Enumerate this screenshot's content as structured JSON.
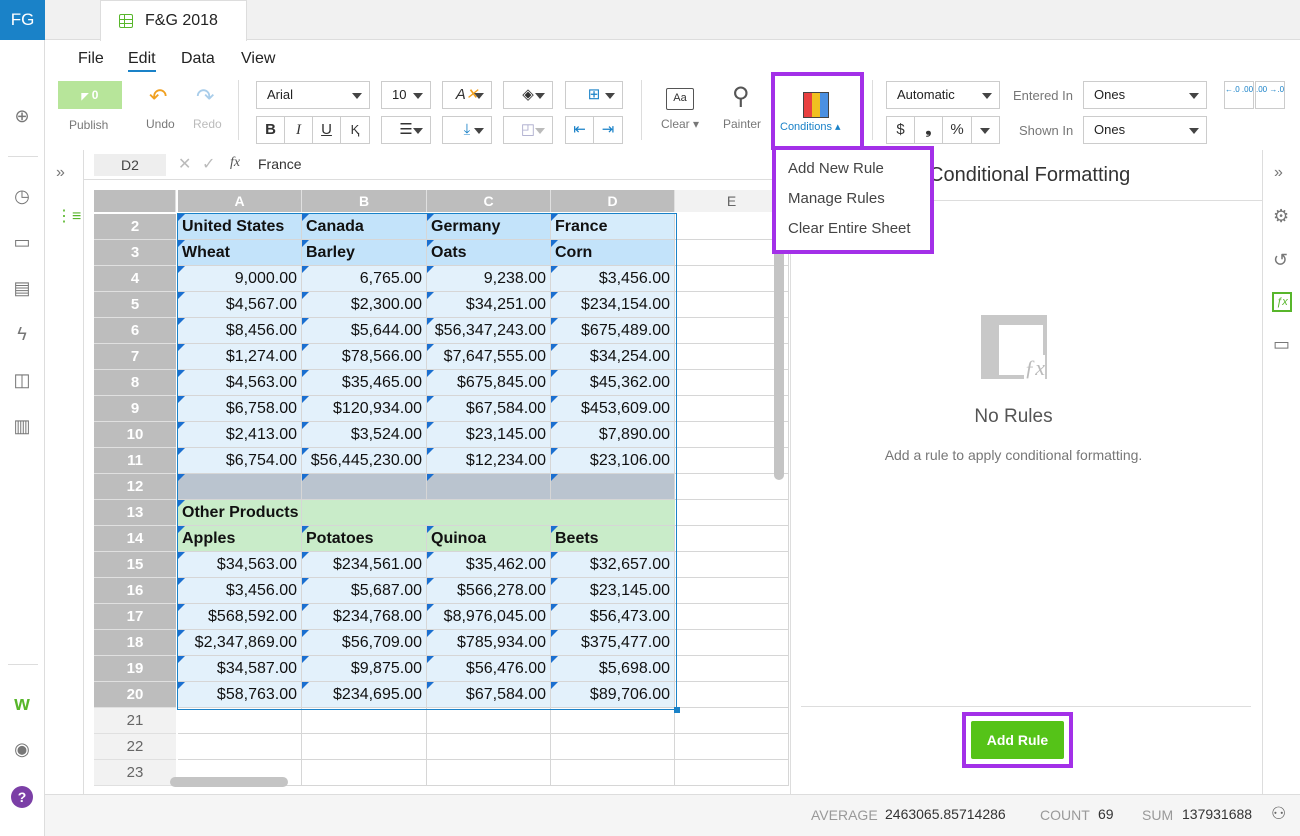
{
  "app": {
    "logo": "FG",
    "tab_title": "F&G 2018"
  },
  "menus": [
    "File",
    "Edit",
    "Data",
    "View"
  ],
  "toolbar": {
    "publish_count": "0",
    "publish_label": "Publish",
    "undo_label": "Undo",
    "redo_label": "Redo",
    "font": "Arial",
    "font_size": "10",
    "bold": "B",
    "italic": "I",
    "underline": "U",
    "clear_label": "Clear",
    "painter_label": "Painter",
    "conditions_label": "Conditions",
    "number_format": "Automatic",
    "currency": "$",
    "comma": "❟",
    "percent": "%",
    "entered_in_label": "Entered In",
    "entered_in_value": "Ones",
    "shown_in_label": "Shown In",
    "shown_in_value": "Ones",
    "dec_increase": "←.0 .00",
    "dec_decrease": ".00 →.0"
  },
  "formula_bar": {
    "cell_ref": "D2",
    "fx": "fx",
    "value": "France"
  },
  "columns": [
    "A",
    "B",
    "C",
    "D",
    "E"
  ],
  "rows": [
    {
      "n": "2",
      "cells": [
        "United States",
        "Canada",
        "Germany",
        "France"
      ],
      "kind": "header"
    },
    {
      "n": "3",
      "cells": [
        "Wheat",
        "Barley",
        "Oats",
        "Corn"
      ],
      "kind": "header"
    },
    {
      "n": "4",
      "cells": [
        "9,000.00",
        "6,765.00",
        "9,238.00",
        "$3,456.00"
      ],
      "kind": "num"
    },
    {
      "n": "5",
      "cells": [
        "$4,567.00",
        "$2,300.00",
        "$34,251.00",
        "$234,154.00"
      ],
      "kind": "num"
    },
    {
      "n": "6",
      "cells": [
        "$8,456.00",
        "$5,644.00",
        "$56,347,243.00",
        "$675,489.00"
      ],
      "kind": "num"
    },
    {
      "n": "7",
      "cells": [
        "$1,274.00",
        "$78,566.00",
        "$7,647,555.00",
        "$34,254.00"
      ],
      "kind": "num"
    },
    {
      "n": "8",
      "cells": [
        "$4,563.00",
        "$35,465.00",
        "$675,845.00",
        "$45,362.00"
      ],
      "kind": "num"
    },
    {
      "n": "9",
      "cells": [
        "$6,758.00",
        "$120,934.00",
        "$67,584.00",
        "$453,609.00"
      ],
      "kind": "num"
    },
    {
      "n": "10",
      "cells": [
        "$2,413.00",
        "$3,524.00",
        "$23,145.00",
        "$7,890.00"
      ],
      "kind": "num"
    },
    {
      "n": "11",
      "cells": [
        "$6,754.00",
        "$56,445,230.00",
        "$12,234.00",
        "$23,106.00"
      ],
      "kind": "num"
    },
    {
      "n": "12",
      "cells": [
        "",
        "",
        "",
        ""
      ],
      "kind": "gray"
    },
    {
      "n": "13",
      "cells": [
        "Other Products",
        "",
        "",
        ""
      ],
      "kind": "green"
    },
    {
      "n": "14",
      "cells": [
        "Apples",
        "Potatoes",
        "Quinoa",
        "Beets"
      ],
      "kind": "green"
    },
    {
      "n": "15",
      "cells": [
        "$34,563.00",
        "$234,561.00",
        "$35,462.00",
        "$32,657.00"
      ],
      "kind": "num"
    },
    {
      "n": "16",
      "cells": [
        "$3,456.00",
        "$5,687.00",
        "$566,278.00",
        "$23,145.00"
      ],
      "kind": "num"
    },
    {
      "n": "17",
      "cells": [
        "$568,592.00",
        "$234,768.00",
        "$8,976,045.00",
        "$56,473.00"
      ],
      "kind": "num"
    },
    {
      "n": "18",
      "cells": [
        "$2,347,869.00",
        "$56,709.00",
        "$785,934.00",
        "$375,477.00"
      ],
      "kind": "num"
    },
    {
      "n": "19",
      "cells": [
        "$34,587.00",
        "$9,875.00",
        "$56,476.00",
        "$5,698.00"
      ],
      "kind": "num"
    },
    {
      "n": "20",
      "cells": [
        "$58,763.00",
        "$234,695.00",
        "$67,584.00",
        "$89,706.00"
      ],
      "kind": "num"
    },
    {
      "n": "21",
      "cells": [
        "",
        "",
        "",
        ""
      ],
      "kind": "empty"
    },
    {
      "n": "22",
      "cells": [
        "",
        "",
        "",
        ""
      ],
      "kind": "empty"
    },
    {
      "n": "23",
      "cells": [
        "",
        "",
        "",
        ""
      ],
      "kind": "empty"
    }
  ],
  "conditions_menu": [
    "Add New Rule",
    "Manage Rules",
    "Clear Entire Sheet"
  ],
  "panel": {
    "title": "Conditional Formatting",
    "empty_title": "No Rules",
    "empty_desc": "Add a rule to apply conditional formatting.",
    "add_rule": "Add Rule"
  },
  "status": {
    "average_label": "AVERAGE",
    "average_value": "2463065.85714286",
    "count_label": "COUNT",
    "count_value": "69",
    "sum_label": "SUM",
    "sum_value": "137931688"
  },
  "colors": {
    "accent": "#1a82c8",
    "highlight": "#a330e8",
    "green": "#58b62b",
    "header_fill": "#c3e3fa",
    "num_fill": "#e3f1fb",
    "green_fill": "#c9ecc9",
    "gray_fill": "#bac4cf"
  }
}
